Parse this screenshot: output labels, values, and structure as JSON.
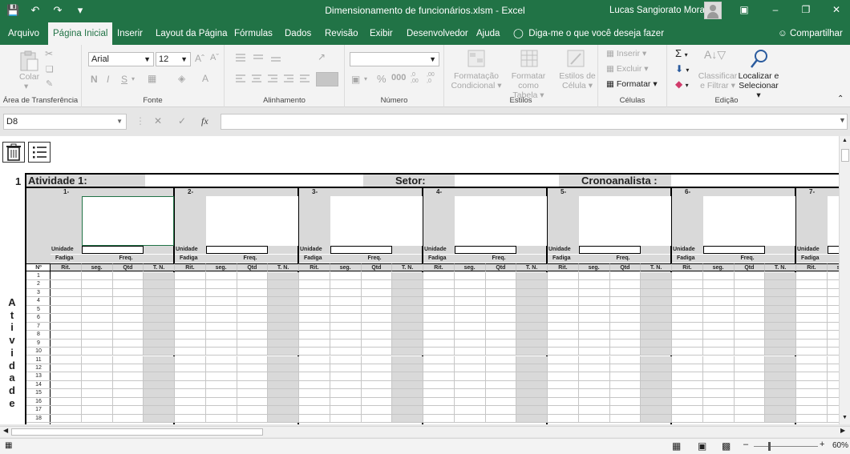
{
  "window": {
    "title": "Dimensionamento de funcionários.xlsm  -  Excel",
    "user": "Lucas Sangiorato Moraes"
  },
  "tabs": [
    "Arquivo",
    "Página Inicial",
    "Inserir",
    "Layout da Página",
    "Fórmulas",
    "Dados",
    "Revisão",
    "Exibir",
    "Desenvolvedor",
    "Ajuda"
  ],
  "active_tab": "Página Inicial",
  "tell_me": "Diga-me o que você deseja fazer",
  "share": "Compartilhar",
  "ribbon": {
    "clipboard": {
      "label": "Área de Transferência",
      "paste": "Colar"
    },
    "font": {
      "label": "Fonte",
      "name": "Arial",
      "size": "12",
      "bold": "N",
      "italic": "I",
      "underline": "S"
    },
    "alignment": {
      "label": "Alinhamento"
    },
    "number": {
      "label": "Número",
      "format": ""
    },
    "styles": {
      "label": "Estilos",
      "conditional": [
        "Formatação",
        "Condicional"
      ],
      "table": [
        "Formatar como",
        "Tabela"
      ],
      "cell_styles": [
        "Estilos de",
        "Célula"
      ]
    },
    "cells": {
      "label": "Células",
      "insert": "Inserir",
      "delete": "Excluir",
      "format": "Formatar"
    },
    "editing": {
      "label": "Edição",
      "sort": [
        "Classificar",
        "e Filtrar"
      ],
      "find": [
        "Localizar e",
        "Selecionar"
      ]
    }
  },
  "formula_bar": {
    "name_box": "D8",
    "fx": "fx",
    "value": ""
  },
  "sheet": {
    "row_label": "1",
    "header": {
      "activity": "Atividade 1:",
      "sector": "Setor:",
      "analyst": "Cronoanalista :"
    },
    "vertical_title": [
      "A",
      "t",
      "i",
      "v",
      "i",
      "d",
      "a",
      "d",
      "e"
    ],
    "blocks": [
      "1-",
      "2-",
      "3-",
      "4-",
      "5-",
      "6-",
      "7-"
    ],
    "labels": {
      "unit": "Unidade",
      "fatigue": "Fadiga",
      "freq": "Freq.",
      "no": "Nº"
    },
    "col_headers": [
      "Rit.",
      "seg.",
      "Qtd",
      "T. N."
    ],
    "rows": [
      "1",
      "2",
      "3",
      "4",
      "5",
      "6",
      "7",
      "8",
      "9",
      "10",
      "11",
      "12",
      "13",
      "14",
      "15",
      "16",
      "17",
      "18"
    ]
  },
  "status": {
    "zoom": "60%"
  },
  "colors": {
    "excel_green": "#217346",
    "header_gray": "#d9d9d9"
  }
}
